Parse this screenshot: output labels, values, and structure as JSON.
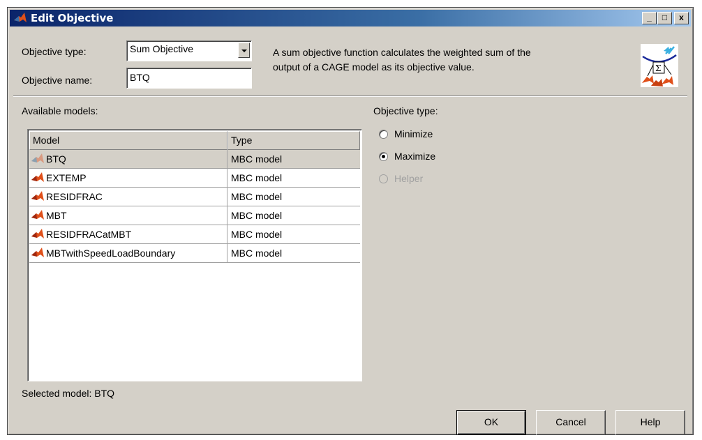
{
  "window": {
    "title": "Edit Objective",
    "controls": {
      "minimize": "_",
      "maximize": "□",
      "close": "x"
    }
  },
  "objective": {
    "type_label": "Objective type:",
    "type_value": "Sum Objective",
    "name_label": "Objective name:",
    "name_value": "BTQ",
    "description_line1": "A sum objective function calculates the weighted sum of the",
    "description_line2": "output of a CAGE model as its objective value."
  },
  "models": {
    "label": "Available models:",
    "columns": [
      "Model",
      "Type"
    ],
    "rows": [
      {
        "name": "BTQ",
        "type": "MBC model",
        "selected": true
      },
      {
        "name": "EXTEMP",
        "type": "MBC model"
      },
      {
        "name": "RESIDFRAC",
        "type": "MBC model"
      },
      {
        "name": "MBT",
        "type": "MBC model"
      },
      {
        "name": "RESIDFRACatMBT",
        "type": "MBC model"
      },
      {
        "name": "MBTwithSpeedLoadBoundary",
        "type": "MBC model"
      }
    ],
    "selected_text": "Selected model: BTQ"
  },
  "goal": {
    "label": "Objective type:",
    "options": [
      {
        "label": "Minimize",
        "checked": false,
        "enabled": true
      },
      {
        "label": "Maximize",
        "checked": true,
        "enabled": true
      },
      {
        "label": "Helper",
        "checked": false,
        "enabled": false
      }
    ]
  },
  "buttons": {
    "ok": "OK",
    "cancel": "Cancel",
    "help": "Help"
  },
  "colors": {
    "face": "#d4d0c8",
    "title_start": "#0a246a",
    "title_end": "#a6caf0",
    "icon": "#e0501a"
  },
  "icons": {
    "app": "matlab-membrane-icon",
    "model": "model-membrane-icon",
    "objective": "sum-objective-icon"
  }
}
